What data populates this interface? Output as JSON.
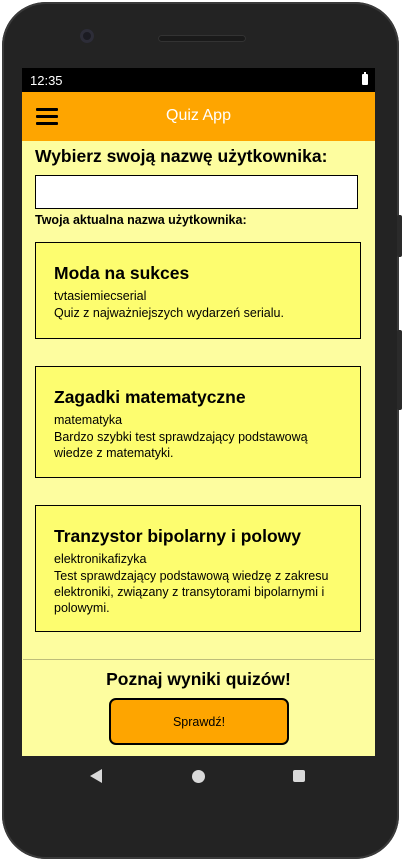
{
  "status_bar": {
    "time": "12:35"
  },
  "app_bar": {
    "title": "Quiz App",
    "menu_icon": "hamburger-menu-icon"
  },
  "form": {
    "prompt": "Wybierz swoją nazwę użytkownika:",
    "username_value": "",
    "current_label": "Twoja aktualna nazwa użytkownika:"
  },
  "quizzes": [
    {
      "title": "Moda na sukces",
      "tag": "tvtasiemiecserial",
      "description": "Quiz z najważniejszych wydarzeń serialu."
    },
    {
      "title": "Zagadki matematyczne",
      "tag": "matematyka",
      "description": "Bardzo szybki test sprawdzający podstawową wiedze z matematyki."
    },
    {
      "title": "Tranzystor bipolarny i polowy",
      "tag": "elektronikafizyka",
      "description": "Test sprawdzający podstawową wiedzę z zakresu elektroniki, związany z transytorami bipolarnymi i polowymi."
    }
  ],
  "results": {
    "title": "Poznaj wyniki quizów!",
    "button_label": "Sprawdź!"
  },
  "nav_bar": {
    "back_icon": "back-triangle-icon",
    "home_icon": "home-circle-icon",
    "recents_icon": "recents-square-icon"
  },
  "colors": {
    "app_bar": "#fea500",
    "background": "#fdfd9f",
    "card": "#fdfd6f",
    "button": "#fea500"
  }
}
